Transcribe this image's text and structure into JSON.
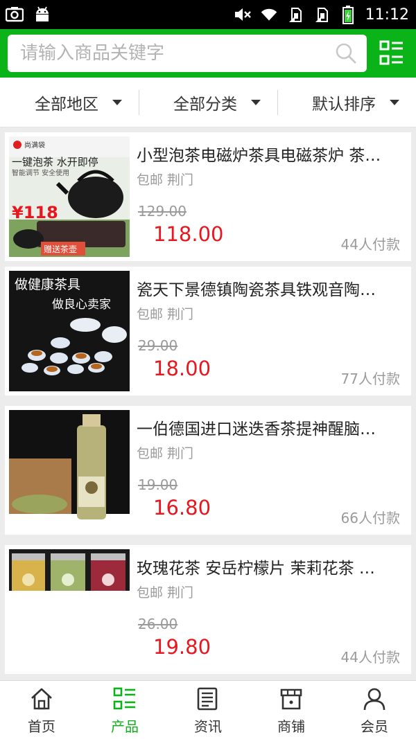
{
  "status_bar": {
    "time": "11:12"
  },
  "search": {
    "placeholder": "请输入商品关键字"
  },
  "filters": [
    {
      "label": "全部地区"
    },
    {
      "label": "全部分类"
    },
    {
      "label": "默认排序"
    }
  ],
  "products": [
    {
      "title": "小型泡茶电磁炉茶具电磁茶炉 茶…",
      "tags": "包邮 荆门",
      "old_price": "129.00",
      "price": "118.00",
      "sales": "44人付款",
      "thumb_text": {
        "brand": "尚满袋",
        "line1": "一键泡茶  水开即停",
        "line2": "智能调节 安全使用",
        "price": "¥118",
        "gift": "赠送茶壶"
      }
    },
    {
      "title": "瓷天下景德镇陶瓷茶具铁观音陶…",
      "tags": "包邮 荆门",
      "old_price": "29.00",
      "price": "18.00",
      "sales": "77人付款",
      "thumb_text": {
        "line1": "做健康茶具",
        "line2": "做良心卖家"
      }
    },
    {
      "title": "一伯德国进口迷迭香茶提神醒脑…",
      "tags": "包邮 荆门",
      "old_price": "19.00",
      "price": "16.80",
      "sales": "66人付款"
    },
    {
      "title": "玫瑰花茶 安岳柠檬片 茉莉花茶 …",
      "tags": "包邮 荆门",
      "old_price": "26.00",
      "price": "19.80",
      "sales": "44人付款"
    }
  ],
  "tabs": [
    {
      "label": "首页",
      "icon": "home-icon",
      "active": false
    },
    {
      "label": "产品",
      "icon": "product-grid-icon",
      "active": true
    },
    {
      "label": "资讯",
      "icon": "news-icon",
      "active": false
    },
    {
      "label": "商铺",
      "icon": "store-icon",
      "active": false
    },
    {
      "label": "会员",
      "icon": "member-icon",
      "active": false
    }
  ],
  "colors": {
    "brand_green": "#0ab317",
    "price_red": "#e8161e"
  }
}
